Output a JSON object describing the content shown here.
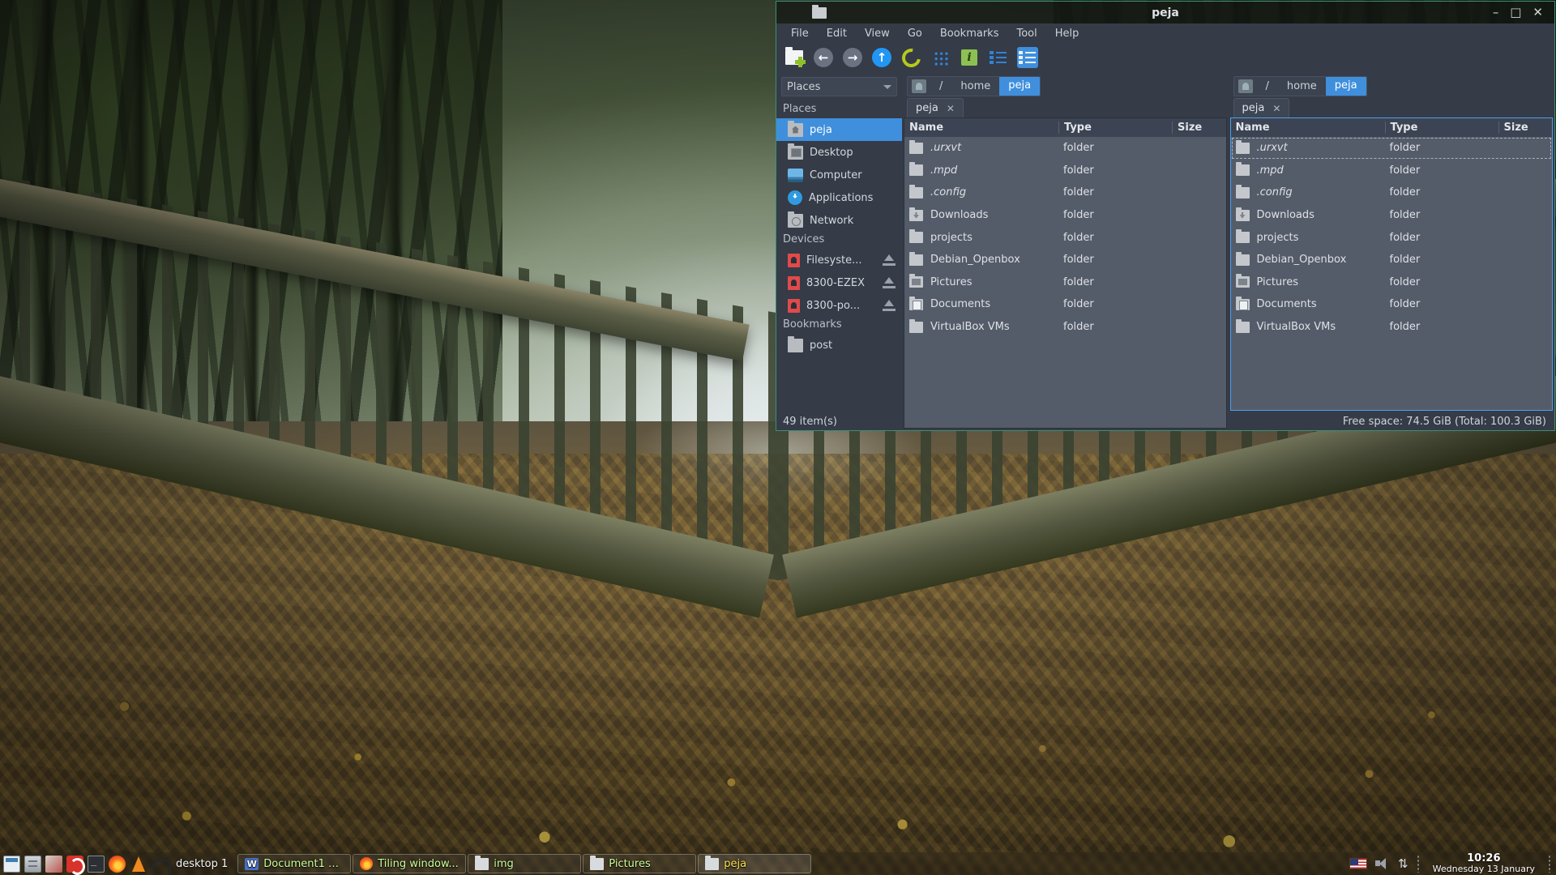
{
  "desktop": {
    "wallpaper_name": "autumn-boardwalk-wallpaper"
  },
  "window": {
    "title": "peja",
    "icon": "folder-icon",
    "controls": {
      "minimize": "–",
      "maximize": "□",
      "close": "✕"
    },
    "menubar": [
      "File",
      "Edit",
      "View",
      "Go",
      "Bookmarks",
      "Tool",
      "Help"
    ],
    "toolbar": [
      {
        "name": "new-tab-button",
        "label": "New Tab"
      },
      {
        "name": "back-button",
        "label": "Back"
      },
      {
        "name": "forward-button",
        "label": "Forward"
      },
      {
        "name": "up-button",
        "label": "Up"
      },
      {
        "name": "reload-button",
        "label": "Reload"
      },
      {
        "name": "icon-view-button",
        "label": "Icon View"
      },
      {
        "name": "info-button",
        "label": "Info"
      },
      {
        "name": "compact-view-button",
        "label": "Compact View"
      },
      {
        "name": "detailed-list-view-button",
        "label": "Detailed List View"
      }
    ],
    "statusbar": {
      "items": "49 item(s)",
      "free_space": "Free space: 74.5 GiB (Total: 100.3 GiB)"
    }
  },
  "sidebar": {
    "combo_label": "Places",
    "groups": [
      {
        "header": "Places",
        "items": [
          {
            "label": "peja",
            "icon": "home-folder-icon",
            "selected": true
          },
          {
            "label": "Desktop",
            "icon": "desktop-icon",
            "selected": false
          },
          {
            "label": "Computer",
            "icon": "computer-icon",
            "selected": false
          },
          {
            "label": "Applications",
            "icon": "applications-icon",
            "selected": false
          },
          {
            "label": "Network",
            "icon": "network-icon",
            "selected": false
          }
        ]
      },
      {
        "header": "Devices",
        "items": [
          {
            "label": "Filesyste...",
            "icon": "disk-icon",
            "eject": true
          },
          {
            "label": "8300-EZEX",
            "icon": "disk-icon",
            "eject": true
          },
          {
            "label": "8300-po...",
            "icon": "disk-icon",
            "eject": true
          }
        ]
      },
      {
        "header": "Bookmarks",
        "items": [
          {
            "label": "post",
            "icon": "folder-icon",
            "eject": false
          }
        ]
      }
    ]
  },
  "panes": [
    {
      "name": "left-pane",
      "focused": false,
      "path": {
        "root_icon": "root-disk-icon",
        "segments": [
          {
            "label": "/",
            "active": false
          },
          {
            "label": "home",
            "active": false
          },
          {
            "label": "peja",
            "active": true
          }
        ]
      },
      "tab": {
        "label": "peja",
        "close": "✕"
      },
      "columns": [
        "Name",
        "Type",
        "Size"
      ],
      "rows": [
        {
          "name": ".urxvt",
          "type": "folder",
          "size": "",
          "icon": "folder-icon",
          "italic": true,
          "focused": false
        },
        {
          "name": ".mpd",
          "type": "folder",
          "size": "",
          "icon": "folder-icon",
          "italic": true,
          "focused": false
        },
        {
          "name": ".config",
          "type": "folder",
          "size": "",
          "icon": "folder-icon",
          "italic": true,
          "focused": false
        },
        {
          "name": "Downloads",
          "type": "folder",
          "size": "",
          "icon": "downloads-folder-icon",
          "italic": false,
          "focused": false
        },
        {
          "name": "projects",
          "type": "folder",
          "size": "",
          "icon": "folder-icon",
          "italic": false,
          "focused": false
        },
        {
          "name": "Debian_Openbox",
          "type": "folder",
          "size": "",
          "icon": "folder-icon",
          "italic": false,
          "focused": false
        },
        {
          "name": "Pictures",
          "type": "folder",
          "size": "",
          "icon": "pictures-folder-icon",
          "italic": false,
          "focused": false
        },
        {
          "name": "Documents",
          "type": "folder",
          "size": "",
          "icon": "documents-folder-icon",
          "italic": false,
          "focused": false
        },
        {
          "name": "VirtualBox VMs",
          "type": "folder",
          "size": "",
          "icon": "folder-icon",
          "italic": false,
          "focused": false
        }
      ]
    },
    {
      "name": "right-pane",
      "focused": true,
      "path": {
        "root_icon": "root-disk-icon",
        "segments": [
          {
            "label": "/",
            "active": false
          },
          {
            "label": "home",
            "active": false
          },
          {
            "label": "peja",
            "active": true
          }
        ]
      },
      "tab": {
        "label": "peja",
        "close": "✕"
      },
      "columns": [
        "Name",
        "Type",
        "Size"
      ],
      "rows": [
        {
          "name": ".urxvt",
          "type": "folder",
          "size": "",
          "icon": "folder-icon",
          "italic": true,
          "focused": true
        },
        {
          "name": ".mpd",
          "type": "folder",
          "size": "",
          "icon": "folder-icon",
          "italic": true,
          "focused": false
        },
        {
          "name": ".config",
          "type": "folder",
          "size": "",
          "icon": "folder-icon",
          "italic": true,
          "focused": false
        },
        {
          "name": "Downloads",
          "type": "folder",
          "size": "",
          "icon": "downloads-folder-icon",
          "italic": false,
          "focused": false
        },
        {
          "name": "projects",
          "type": "folder",
          "size": "",
          "icon": "folder-icon",
          "italic": false,
          "focused": false
        },
        {
          "name": "Debian_Openbox",
          "type": "folder",
          "size": "",
          "icon": "folder-icon",
          "italic": false,
          "focused": false
        },
        {
          "name": "Pictures",
          "type": "folder",
          "size": "",
          "icon": "pictures-folder-icon",
          "italic": false,
          "focused": false
        },
        {
          "name": "Documents",
          "type": "folder",
          "size": "",
          "icon": "documents-folder-icon",
          "italic": false,
          "focused": false
        },
        {
          "name": "VirtualBox VMs",
          "type": "folder",
          "size": "",
          "icon": "folder-icon",
          "italic": false,
          "focused": false
        }
      ]
    }
  ],
  "taskbar": {
    "launchers": [
      {
        "name": "urxvt-launcher",
        "icon": "terminal-icon"
      },
      {
        "name": "file-manager-launcher",
        "icon": "file-cabinet-icon"
      },
      {
        "name": "software-launcher",
        "icon": "software-box-icon"
      },
      {
        "name": "doublecmd-launcher",
        "icon": "double-commander-icon"
      },
      {
        "name": "terminal-launcher",
        "icon": "terminal-prompt-icon"
      },
      {
        "name": "firefox-launcher",
        "icon": "firefox-icon"
      },
      {
        "name": "vlc-launcher",
        "icon": "vlc-cone-icon"
      },
      {
        "name": "audio-launcher",
        "icon": "headphones-icon"
      }
    ],
    "desktop_label": "desktop 1",
    "tasks": [
      {
        "label": "Document1 * -...",
        "icon": "word-document-icon",
        "icon_text": "W",
        "active": false
      },
      {
        "label": "Tiling window...",
        "icon": "firefox-icon",
        "icon_text": "",
        "active": false
      },
      {
        "label": "img",
        "icon": "folder-icon",
        "icon_text": "",
        "active": false
      },
      {
        "label": "Pictures",
        "icon": "folder-icon",
        "icon_text": "",
        "active": false
      },
      {
        "label": "peja",
        "icon": "folder-icon",
        "icon_text": "",
        "active": true
      }
    ],
    "tray": {
      "keyboard_layout": "us-flag-icon",
      "volume": "volume-icon",
      "network": "⇅",
      "clock_time": "10:26",
      "clock_date": "Wednesday 13 January"
    }
  },
  "colors": {
    "accent": "#3f8fdd",
    "window_bg": "#353b47",
    "list_bg": "#555c69",
    "header_bg": "#3c4352",
    "border_green": "#3c8f78",
    "task_text": "#ccff99",
    "task_active_text": "#ffe14d"
  }
}
